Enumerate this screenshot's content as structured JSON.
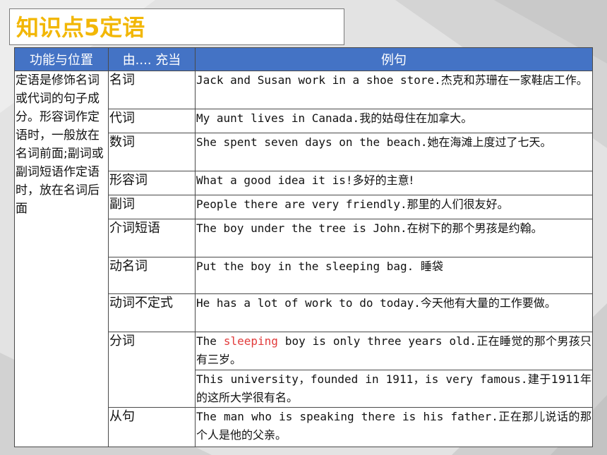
{
  "slide_title": "知识点5定语",
  "table": {
    "headers": [
      "功能与位置",
      "由.... 充当",
      "例句"
    ],
    "function_text": "定语是修饰名词或代词的句子成分。形容词作定语时，一般放在名词前面;副词或副词短语作定语时，放在名词后面",
    "rows": [
      {
        "category": "名词",
        "en": "Jack and Susan work in a shoe store.",
        "zh": "杰克和苏珊在一家鞋店工作。"
      },
      {
        "category": "代词",
        "en": "My aunt lives in Canada.",
        "zh": "我的姑母住在加拿大。"
      },
      {
        "category": "数词",
        "en": "She spent seven days on the beach.",
        "zh": "她在海滩上度过了七天。"
      },
      {
        "category": "形容词",
        "en": "What a good idea it is!",
        "zh": "多好的主意!"
      },
      {
        "category": "副词",
        "en": "People there are very friendly.",
        "zh": "那里的人们很友好。"
      },
      {
        "category": "介词短语",
        "en": "The boy under the tree is John.",
        "zh": "在树下的那个男孩是约翰。"
      },
      {
        "category": "动名词",
        "en": "Put the boy in the sleeping bag. ",
        "zh": "睡袋"
      },
      {
        "category": "动词不定式",
        "en": "He has a lot of work to do today.",
        "zh": "今天他有大量的工作要做。"
      },
      {
        "category": "分词",
        "en_pre": "The ",
        "en_highlight": "sleeping",
        "en_post": " boy is only three years old.",
        "zh": "正在睡觉的那个男孩只有三岁。"
      },
      {
        "category": "",
        "en": "This university，founded in 1911，is very famous.",
        "zh": "建于1911年的这所大学很有名。"
      },
      {
        "category": "从句",
        "en": "The man who is speaking there is his father.",
        "zh": "正在那儿说话的那个人是他的父亲。"
      }
    ]
  },
  "colors": {
    "title": "#f2b705",
    "header_bg": "#4473c5",
    "highlight": "#e23b3b"
  }
}
